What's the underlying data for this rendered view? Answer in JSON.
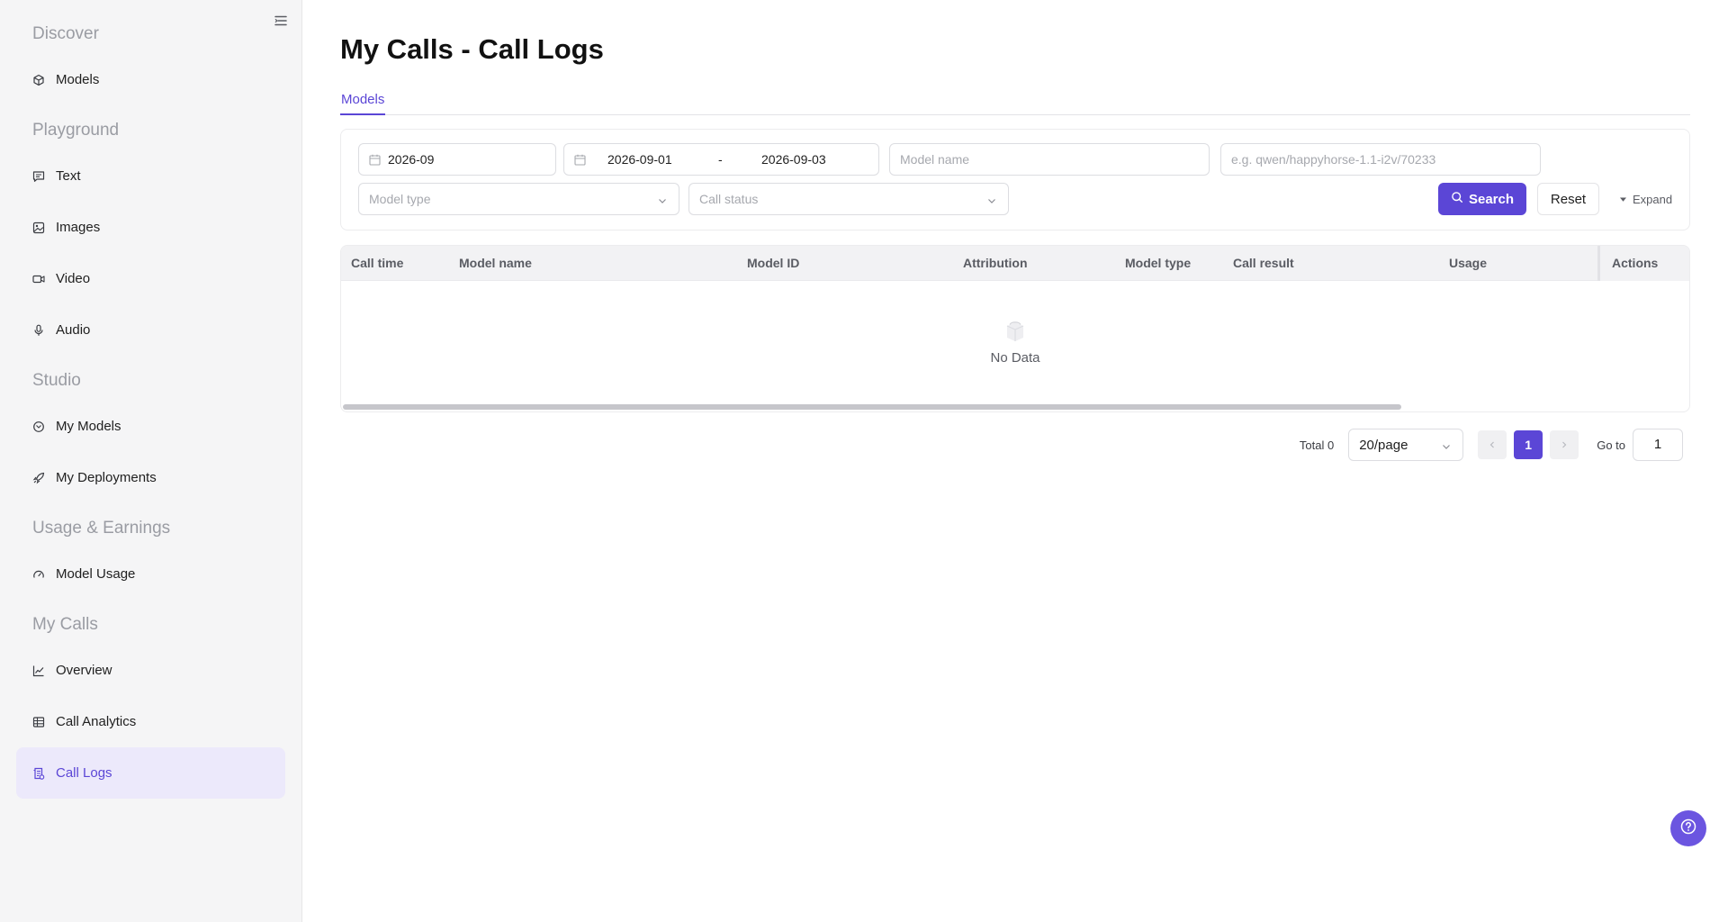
{
  "sidebar": {
    "sections": {
      "discover": "Discover",
      "playground": "Playground",
      "studio": "Studio",
      "usage": "Usage & Earnings",
      "my_calls": "My Calls"
    },
    "items": {
      "models": "Models",
      "text": "Text",
      "images": "Images",
      "video": "Video",
      "audio": "Audio",
      "my_models": "My Models",
      "my_deployments": "My Deployments",
      "model_usage": "Model Usage",
      "overview": "Overview",
      "call_analytics": "Call Analytics",
      "call_logs": "Call Logs"
    },
    "active_item": "Call Logs"
  },
  "page": {
    "title": "My Calls - Call Logs",
    "tab": "Models"
  },
  "filters": {
    "month": "2026-09",
    "range_start": "2026-09-01",
    "range_sep": "-",
    "range_end": "2026-09-03",
    "model_name_placeholder": "Model name",
    "model_id_placeholder": "e.g. qwen/happyhorse-1.1-i2v/70233",
    "model_type_placeholder": "Model type",
    "call_status_placeholder": "Call status",
    "search_label": "Search",
    "reset_label": "Reset",
    "expand_label": "Expand"
  },
  "table": {
    "columns": [
      "Call time",
      "Model name",
      "Model ID",
      "Attribution",
      "Model type",
      "Call result",
      "Usage",
      "Actions"
    ],
    "rows": [],
    "empty_text": "No Data"
  },
  "pagination": {
    "total_label": "Total 0",
    "page_size": "20/page",
    "current_page": "1",
    "goto_label": "Go to",
    "goto_value": "1"
  },
  "colors": {
    "accent": "#5b46d6",
    "active_bg": "#ece9fb",
    "sidebar_bg": "#f5f5f6"
  }
}
